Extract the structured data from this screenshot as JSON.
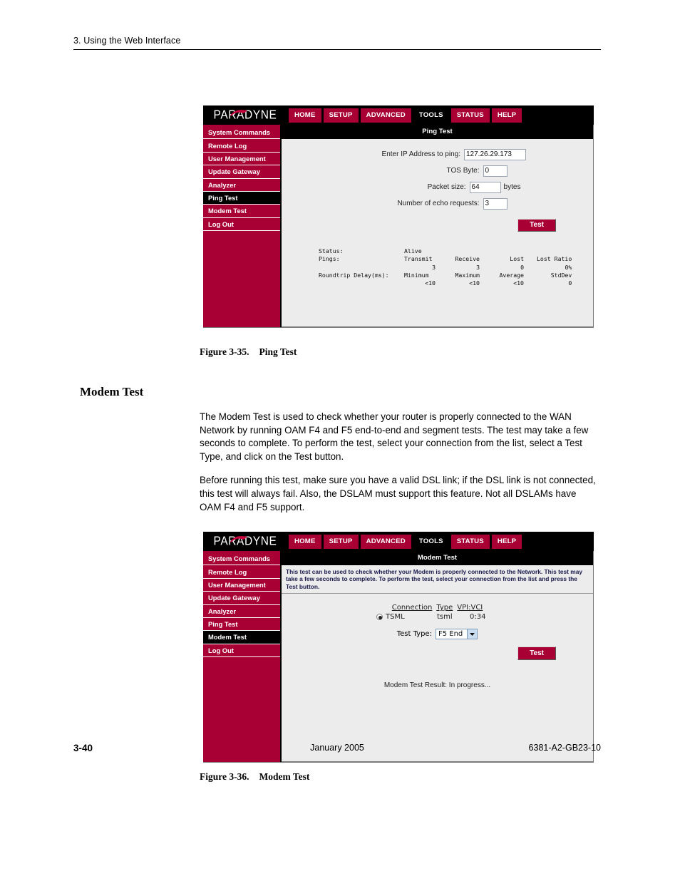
{
  "page": {
    "running_header": "3. Using the Web Interface",
    "footer": {
      "page_number": "3-40",
      "date": "January 2005",
      "doc_number": "6381-A2-GB23-10"
    }
  },
  "section": {
    "heading": "Modem Test",
    "paragraph_1": "The Modem Test is used to check whether your router is properly connected to the WAN Network by running OAM F4 and F5 end-to-end and segment tests. The test may take a few seconds to complete. To perform the test, select your connection from the list, select a Test Type, and click on the Test button.",
    "paragraph_2": "Before running this test, make sure you have a valid DSL link; if the DSL link is not connected, this test will always fail. Also, the DSLAM must support this feature. Not all DSLAMs have OAM F4 and F5 support."
  },
  "figures": {
    "ping": {
      "number": "Figure 3-35.",
      "title": "Ping Test"
    },
    "modem": {
      "number": "Figure 3-36.",
      "title": "Modem Test"
    }
  },
  "router_ui": {
    "brand": "PARADYNE",
    "nav": [
      {
        "label": "HOME",
        "active": false
      },
      {
        "label": "SETUP",
        "active": false
      },
      {
        "label": "ADVANCED",
        "active": false
      },
      {
        "label": "TOOLS",
        "active": true
      },
      {
        "label": "STATUS",
        "active": false
      },
      {
        "label": "HELP",
        "active": false
      }
    ],
    "sidebar": [
      "System Commands",
      "Remote Log",
      "User Management",
      "Update Gateway",
      "Analyzer",
      "Ping Test",
      "Modem Test",
      "Log Out"
    ],
    "colors": {
      "brand_red": "#a80034",
      "active_black": "#000000",
      "content_gray": "#ececec"
    }
  },
  "ping_test": {
    "title": "Ping Test",
    "fields": {
      "ip_label": "Enter IP Address to ping:",
      "ip_value": "127.26.29.173",
      "tos_label": "TOS Byte:",
      "tos_value": "0",
      "packet_label": "Packet size:",
      "packet_value": "64",
      "packet_unit": "bytes",
      "echo_label": "Number of echo requests:",
      "echo_value": "3"
    },
    "test_button": "Test",
    "results": {
      "status_label": "Status:",
      "status_value": "Alive",
      "pings_label": "Pings:",
      "pings_headers": [
        "Transmit",
        "Receive",
        "Lost",
        "Lost Ratio"
      ],
      "pings_values": [
        "3",
        "3",
        "0",
        "0%"
      ],
      "delay_label": "Roundtrip Delay(ms):",
      "delay_headers": [
        "Minimum",
        "Maximum",
        "Average",
        "StdDev"
      ],
      "delay_values": [
        "<10",
        "<10",
        "<10",
        "0"
      ]
    },
    "sidebar_active": "Ping Test"
  },
  "modem_test": {
    "title": "Modem Test",
    "description": "This test can be used to check whether your Modem is properly connected to the Network. This test may take a few seconds to complete. To perform the test, select your connection from the list and press the Test button.",
    "table_headers": {
      "connection": "Connection",
      "type": "Type",
      "vpivci": "VPI:VCI"
    },
    "connection_row": {
      "name": "TSML",
      "type": "tsml",
      "vpivci": "0:34",
      "selected": true
    },
    "test_type_label": "Test Type:",
    "test_type_value": "F5 End",
    "test_button": "Test",
    "result": "Modem Test Result: In progress...",
    "sidebar_active": "Modem Test"
  }
}
